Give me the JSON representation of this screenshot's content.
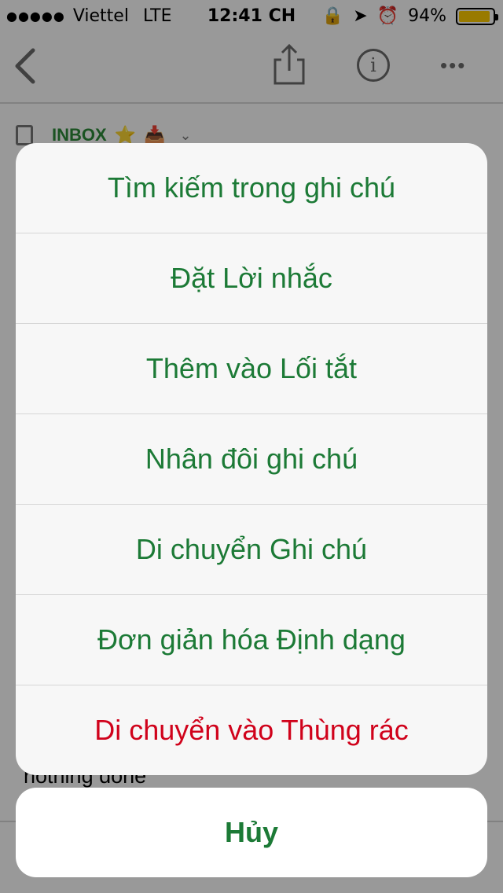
{
  "status_bar": {
    "carrier": "Viettel",
    "network": "LTE",
    "time": "12:41 CH",
    "battery_percent": "94%",
    "battery_level": 0.94
  },
  "note": {
    "notebook_label": "INBOX",
    "body_text": "nothing done"
  },
  "action_sheet": {
    "items": [
      {
        "label": "Tìm kiếm trong ghi chú"
      },
      {
        "label": "Đặt Lời nhắc"
      },
      {
        "label": "Thêm vào Lối tắt"
      },
      {
        "label": "Nhân đôi ghi chú"
      },
      {
        "label": "Di chuyển Ghi chú"
      },
      {
        "label": "Đơn giản hóa Định dạng"
      },
      {
        "label": "Di chuyển vào Thùng rác"
      }
    ],
    "cancel_label": "Hủy"
  },
  "colors": {
    "action_green": "#1c7a36",
    "destructive_red": "#d0021b",
    "notebook_green": "#2e8b3a"
  }
}
